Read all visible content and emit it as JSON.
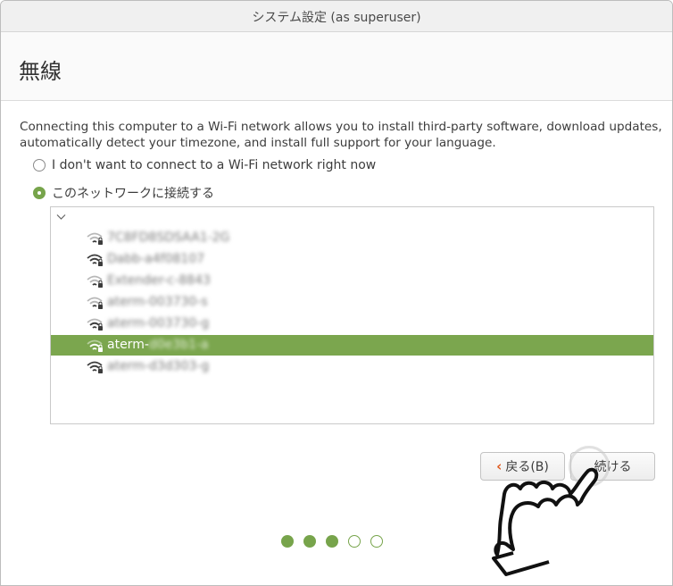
{
  "window": {
    "title": "システム設定 (as superuser)"
  },
  "header": {
    "title": "無線"
  },
  "description": "Connecting this computer to a Wi-Fi network allows you to install third-party software, download updates, automatically detect your timezone, and install full support for your language.",
  "options": [
    {
      "label": "I don't want to connect to a Wi-Fi network right now",
      "checked": false
    },
    {
      "label": "このネットワークに接続する",
      "checked": true
    }
  ],
  "networks": {
    "expand_icon": "chevron-down-icon",
    "items": [
      {
        "ssid": "7C8FD8SDSAA1-2G",
        "signal": "weak",
        "secured": true,
        "selected": false,
        "blurred": true
      },
      {
        "ssid": "Dabb-a4f08107",
        "signal": "strong",
        "secured": true,
        "selected": false,
        "blurred": true
      },
      {
        "ssid": "Extender-c-8843",
        "signal": "weak",
        "secured": true,
        "selected": false,
        "blurred": true
      },
      {
        "ssid": "aterm-003730-s",
        "signal": "weak",
        "secured": true,
        "selected": false,
        "blurred": true
      },
      {
        "ssid": "aterm-003730-g",
        "signal": "medium",
        "secured": true,
        "selected": false,
        "blurred": true
      },
      {
        "ssid_prefix": "aterm-",
        "ssid_suffix": "d0e3b1-a",
        "signal": "medium",
        "secured": true,
        "selected": true,
        "blurred": false
      },
      {
        "ssid": "aterm-d3d303-g",
        "signal": "strong",
        "secured": true,
        "selected": false,
        "blurred": true
      }
    ]
  },
  "buttons": {
    "back": {
      "label": "戻る(B)",
      "icon": "chevron-left-icon"
    },
    "continue": {
      "label": "続ける"
    }
  },
  "progress": {
    "current": 3,
    "total": 5
  },
  "colors": {
    "accent": "#77a44b",
    "selected_row": "#7ba64e",
    "back_arrow": "#e05a1e"
  }
}
